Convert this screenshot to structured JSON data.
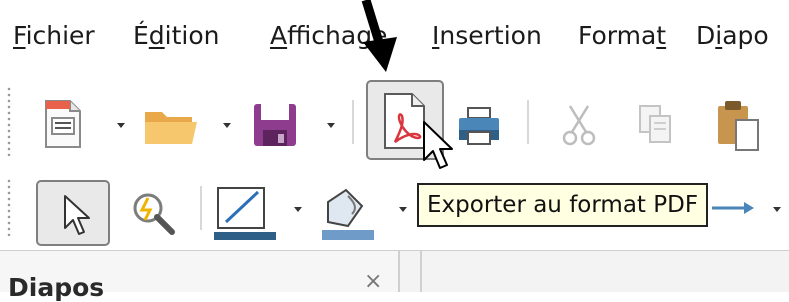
{
  "menubar": {
    "items": [
      {
        "pre": "",
        "acc": "F",
        "post": "ichier"
      },
      {
        "pre": "É",
        "acc": "d",
        "post": "ition"
      },
      {
        "pre": "",
        "acc": "A",
        "post": "ffichage"
      },
      {
        "pre": "",
        "acc": "I",
        "post": "nsertion"
      },
      {
        "pre": "Forma",
        "acc": "t",
        "post": ""
      },
      {
        "pre": "D",
        "acc": "i",
        "post": "apo"
      }
    ]
  },
  "standard_toolbar": {
    "buttons": [
      "new-icon",
      "open-folder-icon",
      "save-icon",
      "export-pdf-icon",
      "print-icon",
      "cut-icon",
      "copy-icon",
      "paste-icon"
    ]
  },
  "drawing_toolbar": {
    "buttons": [
      "select-arrow-icon",
      "zoom-pan-icon",
      "line-color-icon",
      "fill-color-icon",
      "connector-arrow-icon"
    ]
  },
  "tooltip": {
    "text": "Exporter au format PDF"
  },
  "sidebar": {
    "title": "Diapos",
    "close": "×"
  },
  "colors": {
    "tooltip_bg": "#ffffe1",
    "save_purple": "#8e3c8e",
    "folder_orange": "#f4b860",
    "pdf_red": "#d9363e"
  }
}
